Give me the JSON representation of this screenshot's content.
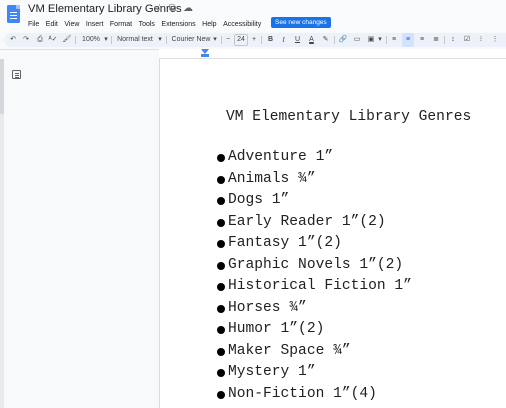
{
  "title_bar": {
    "doc_title": "VM Elementary Library Genres",
    "icons": [
      "star-icon",
      "move-to-folder-icon",
      "cloud-saved-icon"
    ]
  },
  "menu": {
    "items": [
      "File",
      "Edit",
      "View",
      "Insert",
      "Format",
      "Tools",
      "Extensions",
      "Help",
      "Accessibility"
    ],
    "see_new_changes": "See new changes"
  },
  "toolbar": {
    "zoom": "100%",
    "style": "Normal text",
    "font": "Courier New",
    "font_size": "24",
    "minus": "−",
    "plus": "+",
    "bold": "B",
    "italic": "I",
    "underline": "U",
    "text_color": "A",
    "more": "⋮",
    "accent_color": "#0b57d0"
  },
  "document": {
    "heading": "VM Elementary Library Genres",
    "genres": [
      "Adventure 1”",
      "Animals ¾”",
      "Dogs 1”",
      "Early Reader 1”(2)",
      "Fantasy 1”(2)",
      "Graphic Novels 1”(2)",
      "Historical Fiction 1”",
      "Horses ¾”",
      "Humor 1”(2)",
      "Maker Space ¾”",
      "Mystery 1”",
      "Non-Fiction 1”(4)"
    ]
  }
}
